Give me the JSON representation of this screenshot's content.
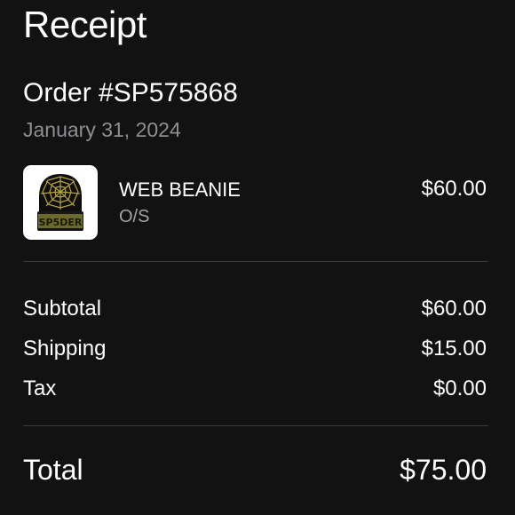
{
  "header": {
    "title": "Receipt"
  },
  "order": {
    "number": "Order #SP575868",
    "date": "January 31, 2024"
  },
  "item": {
    "name": "WEB BEANIE",
    "variant": "O/S",
    "price": "$60.00",
    "image_icon": "beanie-product-image",
    "image_text": "SP5DER"
  },
  "summary": {
    "subtotal_label": "Subtotal",
    "subtotal_value": "$60.00",
    "shipping_label": "Shipping",
    "shipping_value": "$15.00",
    "tax_label": "Tax",
    "tax_value": "$0.00"
  },
  "total": {
    "label": "Total",
    "value": "$75.00"
  },
  "colors": {
    "background": "#121212",
    "text_primary": "#ffffff",
    "text_secondary": "#8e8e93",
    "divider": "#3a3a3c",
    "beanie_body": "#0e0e0e",
    "beanie_web": "#b9a43c"
  }
}
